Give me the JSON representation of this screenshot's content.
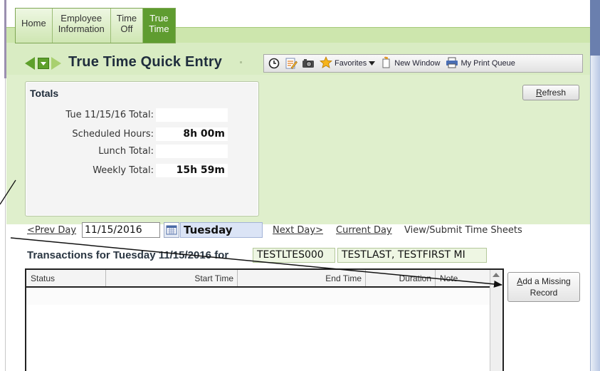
{
  "nav_tabs": [
    {
      "label": "Home"
    },
    {
      "label": "Employee\nInformation"
    },
    {
      "label": "Time\nOff"
    },
    {
      "label": "True\nTime"
    }
  ],
  "page_title": "True Time Quick Entry",
  "toolbar": {
    "favorites_label": "Favorites",
    "new_window_label": "New Window",
    "print_queue_label": "My Print Queue",
    "icons": [
      "clock-icon",
      "edit-notes-icon",
      "camera-icon",
      "star-icon",
      "new-window-icon",
      "printer-icon"
    ]
  },
  "totals": {
    "title": "Totals",
    "rows": [
      {
        "label": "Tue 11/15/16 Total:",
        "value": ""
      },
      {
        "label": "Scheduled Hours:",
        "value": "8h 00m"
      },
      {
        "label": "Lunch Total:",
        "value": ""
      },
      {
        "label": "Weekly Total:",
        "value": "15h 59m"
      }
    ]
  },
  "refresh_label": "Refresh",
  "date_nav": {
    "prev_day": "<Prev Day",
    "date_value": "11/15/2016",
    "day_name": "Tuesday",
    "next_day": "Next Day>",
    "current_day": "Current Day",
    "view_submit": "View/Submit Time Sheets"
  },
  "transactions": {
    "title": "Transactions for Tuesday 11/15/2016 for",
    "employee_id": "TESTLTES000",
    "employee_name": "TESTLAST, TESTFIRST MI",
    "columns": [
      "Status",
      "Start Time",
      "End Time",
      "Duration",
      "Note"
    ],
    "rows": []
  },
  "add_missing_label": "Add a Missing Record",
  "colors": {
    "nav_active": "#5f9c30",
    "panel_green": "#dfefcc",
    "accent_green": "#5ea02b"
  }
}
